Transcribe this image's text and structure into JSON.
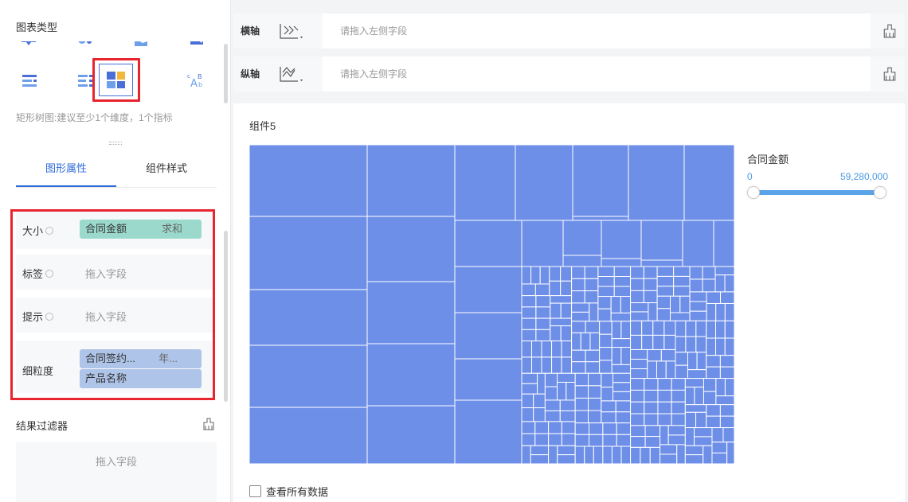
{
  "left_panel": {
    "chart_type_title": "图表类型",
    "chart_icons": [
      "bar-h-icon",
      "bubble-icon",
      "area-icon",
      "scatter-icon",
      "stack-icon"
    ],
    "chart_icons_row2": [
      "grouped-bar-icon",
      "bar-list-icon",
      "treemap-icon",
      "word-cloud-icon",
      "funnel-icon"
    ],
    "chart_hint": "矩形树图:建议至少1个维度，1个指标",
    "tabs": [
      "图形属性",
      "组件样式"
    ],
    "properties": {
      "size_label": "大小",
      "size_field": "合同金额",
      "size_agg": "求和",
      "label_label": "标签",
      "label_placeholder": "拖入字段",
      "tooltip_label": "提示",
      "tooltip_placeholder": "拖入字段",
      "granularity_label": "细粒度",
      "granularity_field1": "合同签约...",
      "granularity_field1_sub": "年...",
      "granularity_field2": "产品名称"
    },
    "result_filter_title": "结果过滤器",
    "result_filter_placeholder": "拖入字段"
  },
  "x_axis": {
    "label": "横轴",
    "placeholder": "请拖入左侧字段"
  },
  "y_axis": {
    "label": "纵轴",
    "placeholder": "请拖入左侧字段"
  },
  "component": {
    "title": "组件5",
    "legend_title": "合同金额",
    "legend_min": "0",
    "legend_max": "59,280,000",
    "view_all_label": "查看所有数据"
  },
  "colors": {
    "accent": "#2f6bd8",
    "treemap_fill": "#6e8fe8",
    "highlight": "#e8242f"
  }
}
